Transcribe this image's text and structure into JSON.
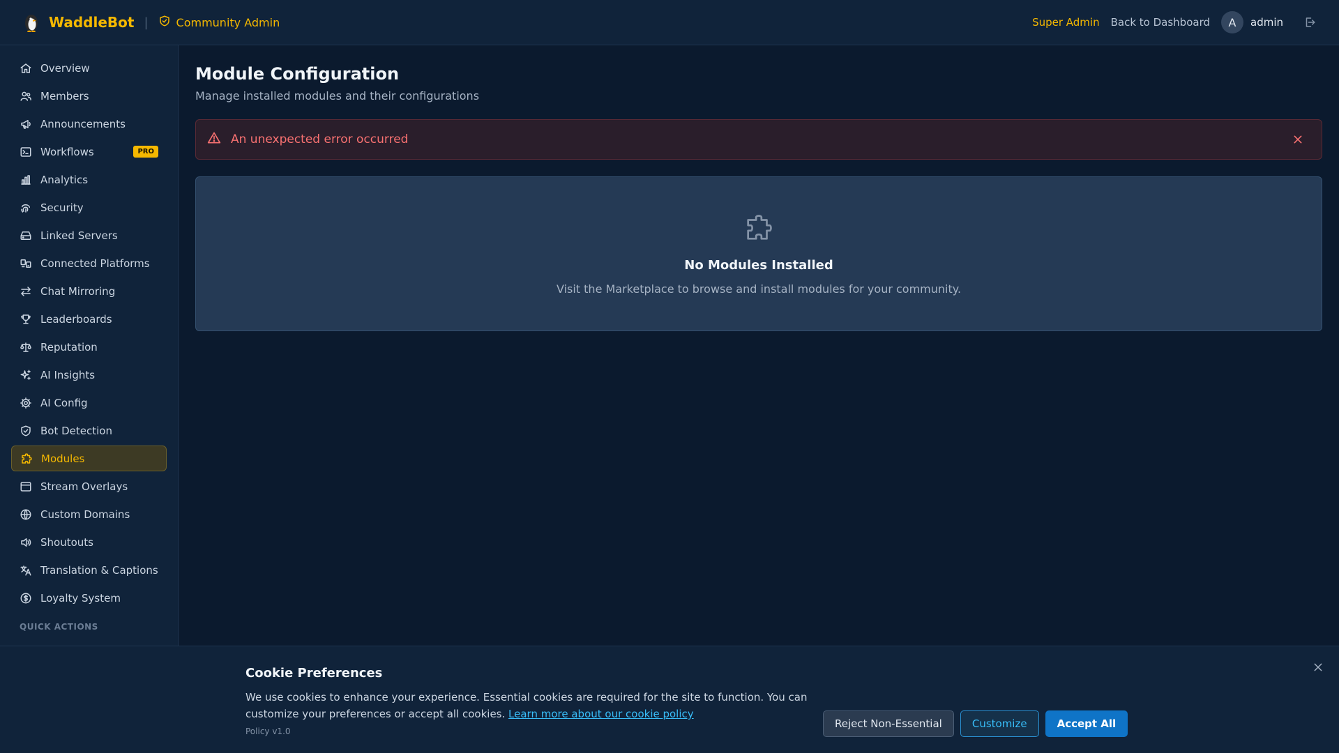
{
  "colors": {
    "accent": "#f5b800",
    "error": "#f87171",
    "link": "#38bdf8",
    "primary_button": "#0f74c7"
  },
  "header": {
    "brand": "WaddleBot",
    "section": "Community Admin",
    "super_admin": "Super Admin",
    "back": "Back to Dashboard",
    "avatar_initial": "A",
    "username": "admin"
  },
  "sidebar": {
    "items": [
      {
        "label": "Overview",
        "icon": "home-icon"
      },
      {
        "label": "Members",
        "icon": "users-icon"
      },
      {
        "label": "Announcements",
        "icon": "megaphone-icon"
      },
      {
        "label": "Workflows",
        "icon": "terminal-icon",
        "badge": "PRO"
      },
      {
        "label": "Analytics",
        "icon": "bar-chart-icon"
      },
      {
        "label": "Security",
        "icon": "fingerprint-icon"
      },
      {
        "label": "Linked Servers",
        "icon": "server-icon"
      },
      {
        "label": "Connected Platforms",
        "icon": "platforms-icon"
      },
      {
        "label": "Chat Mirroring",
        "icon": "arrows-icon"
      },
      {
        "label": "Leaderboards",
        "icon": "trophy-icon"
      },
      {
        "label": "Reputation",
        "icon": "scale-icon"
      },
      {
        "label": "AI Insights",
        "icon": "sparkles-icon"
      },
      {
        "label": "AI Config",
        "icon": "gear-icon"
      },
      {
        "label": "Bot Detection",
        "icon": "shield-check-icon"
      },
      {
        "label": "Modules",
        "icon": "puzzle-icon",
        "active": true
      },
      {
        "label": "Stream Overlays",
        "icon": "window-icon"
      },
      {
        "label": "Custom Domains",
        "icon": "globe-icon"
      },
      {
        "label": "Shoutouts",
        "icon": "speaker-icon"
      },
      {
        "label": "Translation & Captions",
        "icon": "translate-icon"
      },
      {
        "label": "Loyalty System",
        "icon": "dollar-icon"
      }
    ],
    "quick_actions_heading": "QUICK ACTIONS"
  },
  "main": {
    "title": "Module Configuration",
    "subtitle": "Manage installed modules and their configurations",
    "error": "An unexpected error occurred",
    "empty_title": "No Modules Installed",
    "empty_desc": "Visit the Marketplace to browse and install modules for your community."
  },
  "cookie": {
    "title": "Cookie Preferences",
    "text": "We use cookies to enhance your experience. Essential cookies are required for the site to function. You can customize your preferences or accept all cookies.",
    "link": "Learn more about our cookie policy",
    "version": "Policy v1.0",
    "reject": "Reject Non-Essential",
    "customize": "Customize",
    "accept": "Accept All"
  }
}
